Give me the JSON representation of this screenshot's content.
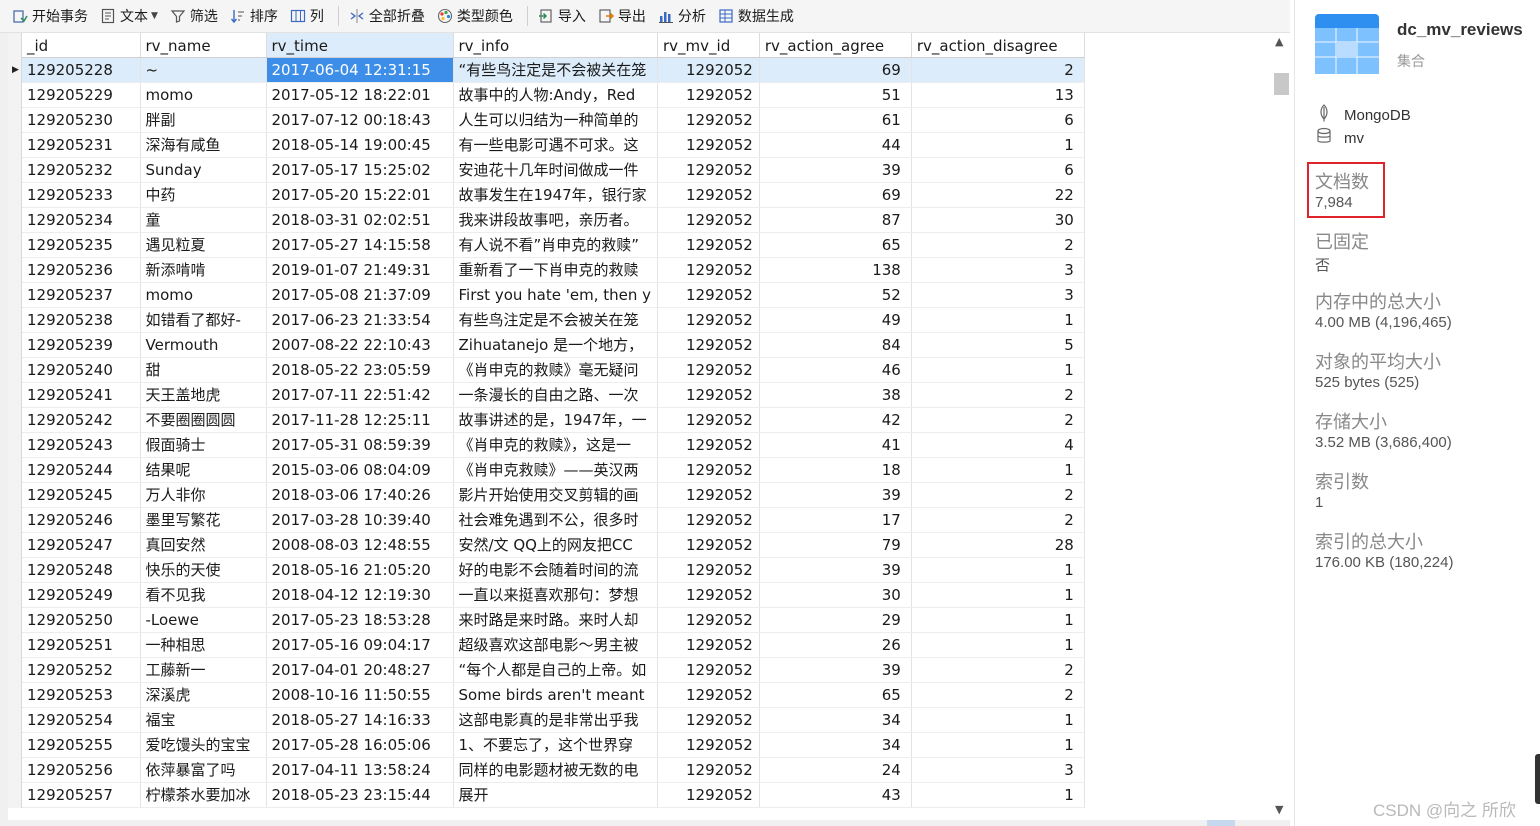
{
  "toolbar": {
    "items": [
      {
        "icon": "transaction-icon",
        "label": "开始事务"
      },
      {
        "icon": "text-icon",
        "label": "文本"
      },
      {
        "icon": "filter-icon",
        "label": "筛选"
      },
      {
        "icon": "sort-icon",
        "label": "排序"
      },
      {
        "icon": "columns-icon",
        "label": "列"
      },
      {
        "icon": "collapse-icon",
        "label": "全部折叠"
      },
      {
        "icon": "palette-icon",
        "label": "类型颜色"
      },
      {
        "icon": "import-icon",
        "label": "导入"
      },
      {
        "icon": "export-icon",
        "label": "导出"
      },
      {
        "icon": "analyze-icon",
        "label": "分析"
      },
      {
        "icon": "data-gen-icon",
        "label": "数据生成"
      }
    ]
  },
  "grid": {
    "columns": [
      "_id",
      "rv_name",
      "rv_time",
      "rv_info",
      "rv_mv_id",
      "rv_action_agree",
      "rv_action_disagree"
    ],
    "rows": [
      [
        "129205228",
        "~",
        "2017-06-04 12:31:15",
        "“有些鸟注定是不会被关在笼",
        "1292052",
        "69",
        "2"
      ],
      [
        "129205229",
        "momo",
        "2017-05-12 18:22:01",
        "故事中的人物:Andy，Red",
        "1292052",
        "51",
        "13"
      ],
      [
        "129205230",
        "胖副",
        "2017-07-12 00:18:43",
        "人生可以归结为一种简单的",
        "1292052",
        "61",
        "6"
      ],
      [
        "129205231",
        "深海有咸鱼",
        "2018-05-14 19:00:45",
        "有一些电影可遇不可求。这",
        "1292052",
        "44",
        "1"
      ],
      [
        "129205232",
        "Sunday",
        "2017-05-17 15:25:02",
        "安迪花十几年时间做成一件",
        "1292052",
        "39",
        "6"
      ],
      [
        "129205233",
        "中药",
        "2017-05-20 15:22:01",
        "故事发生在1947年，银行家",
        "1292052",
        "69",
        "22"
      ],
      [
        "129205234",
        "童",
        "2018-03-31 02:02:51",
        "我来讲段故事吧，亲历者。",
        "1292052",
        "87",
        "30"
      ],
      [
        "129205235",
        "遇见粒夏",
        "2017-05-27 14:15:58",
        "有人说不看”肖申克的救赎”",
        "1292052",
        "65",
        "2"
      ],
      [
        "129205236",
        "新添啃啃",
        "2019-01-07 21:49:31",
        "重新看了一下肖申克的救赎",
        "1292052",
        "138",
        "3"
      ],
      [
        "129205237",
        "momo",
        "2017-05-08 21:37:09",
        "First you hate 'em, then y",
        "1292052",
        "52",
        "3"
      ],
      [
        "129205238",
        "如错看了都好-",
        "2017-06-23 21:33:54",
        "有些鸟注定是不会被关在笼",
        "1292052",
        "49",
        "1"
      ],
      [
        "129205239",
        "Vermouth",
        "2007-08-22 22:10:43",
        "Zihuatanejo 是一个地方，",
        "1292052",
        "84",
        "5"
      ],
      [
        "129205240",
        "甜",
        "2018-05-22 23:05:59",
        "《肖申克的救赎》毫无疑问",
        "1292052",
        "46",
        "1"
      ],
      [
        "129205241",
        "天王盖地虎",
        "2017-07-11 22:51:42",
        "一条漫长的自由之路、一次",
        "1292052",
        "38",
        "2"
      ],
      [
        "129205242",
        "不要圈圈圆圆",
        "2017-11-28 12:25:11",
        "故事讲述的是，1947年，一",
        "1292052",
        "42",
        "2"
      ],
      [
        "129205243",
        "假面骑士",
        "2017-05-31 08:59:39",
        "《肖申克的救赎》，这是一",
        "1292052",
        "41",
        "4"
      ],
      [
        "129205244",
        "结果呢",
        "2015-03-06 08:04:09",
        "《肖申克救赎》——英汉两",
        "1292052",
        "18",
        "1"
      ],
      [
        "129205245",
        "万人非你",
        "2018-03-06 17:40:26",
        "影片开始使用交叉剪辑的画",
        "1292052",
        "39",
        "2"
      ],
      [
        "129205246",
        "墨里写繁花",
        "2017-03-28 10:39:40",
        "社会难免遇到不公，很多时",
        "1292052",
        "17",
        "2"
      ],
      [
        "129205247",
        "真回安然",
        "2008-08-03 12:48:55",
        "安然/文  QQ上的网友把CC",
        "1292052",
        "79",
        "28"
      ],
      [
        "129205248",
        "快乐的天使",
        "2018-05-16 21:05:20",
        "好的电影不会随着时间的流",
        "1292052",
        "39",
        "1"
      ],
      [
        "129205249",
        "看不见我",
        "2018-04-12 12:19:30",
        "一直以来挺喜欢那句：梦想",
        "1292052",
        "30",
        "1"
      ],
      [
        "129205250",
        "-Loewe",
        "2017-05-23 18:53:28",
        "来时路是来时路。来时人却",
        "1292052",
        "29",
        "1"
      ],
      [
        "129205251",
        "一种相思",
        "2017-05-16 09:04:17",
        "超级喜欢这部电影～男主被",
        "1292052",
        "26",
        "1"
      ],
      [
        "129205252",
        "工藤新一",
        "2017-04-01 20:48:27",
        "“每个人都是自己的上帝。如",
        "1292052",
        "39",
        "2"
      ],
      [
        "129205253",
        "深溪虎",
        "2008-10-16 11:50:55",
        "Some birds aren't meant",
        "1292052",
        "65",
        "2"
      ],
      [
        "129205254",
        "福宝",
        "2018-05-27 14:16:33",
        "这部电影真的是非常出乎我",
        "1292052",
        "34",
        "1"
      ],
      [
        "129205255",
        "爱吃馒头的宝宝",
        "2017-05-28 16:05:06",
        "1、不要忘了，这个世界穿",
        "1292052",
        "34",
        "1"
      ],
      [
        "129205256",
        "依萍暴富了吗",
        "2017-04-11 13:58:24",
        "同样的电影题材被无数的电",
        "1292052",
        "24",
        "3"
      ],
      [
        "129205257",
        "柠檬茶水要加冰",
        "2018-05-23 23:15:44",
        "展开",
        "1292052",
        "43",
        "1"
      ]
    ]
  },
  "panel": {
    "collection_name": "dc_mv_reviews",
    "collection_type": "集合",
    "connection": "MongoDB",
    "database": "mv",
    "props": [
      {
        "label": "文档数",
        "value": "7,984"
      },
      {
        "label": "已固定",
        "value": "否"
      },
      {
        "label": "内存中的总大小",
        "value": "4.00 MB (4,196,465)"
      },
      {
        "label": "对象的平均大小",
        "value": "525 bytes (525)"
      },
      {
        "label": "存储大小",
        "value": "3.52 MB (3,686,400)"
      },
      {
        "label": "索引数",
        "value": "1"
      },
      {
        "label": "索引的总大小",
        "value": "176.00 KB (180,224)"
      }
    ],
    "watermark": "CSDN @向之 所欣"
  },
  "colors": {
    "selection_bg": "#dcecfb",
    "selected_cell": "#3d8ee8",
    "highlight_box": "#e0232b"
  }
}
